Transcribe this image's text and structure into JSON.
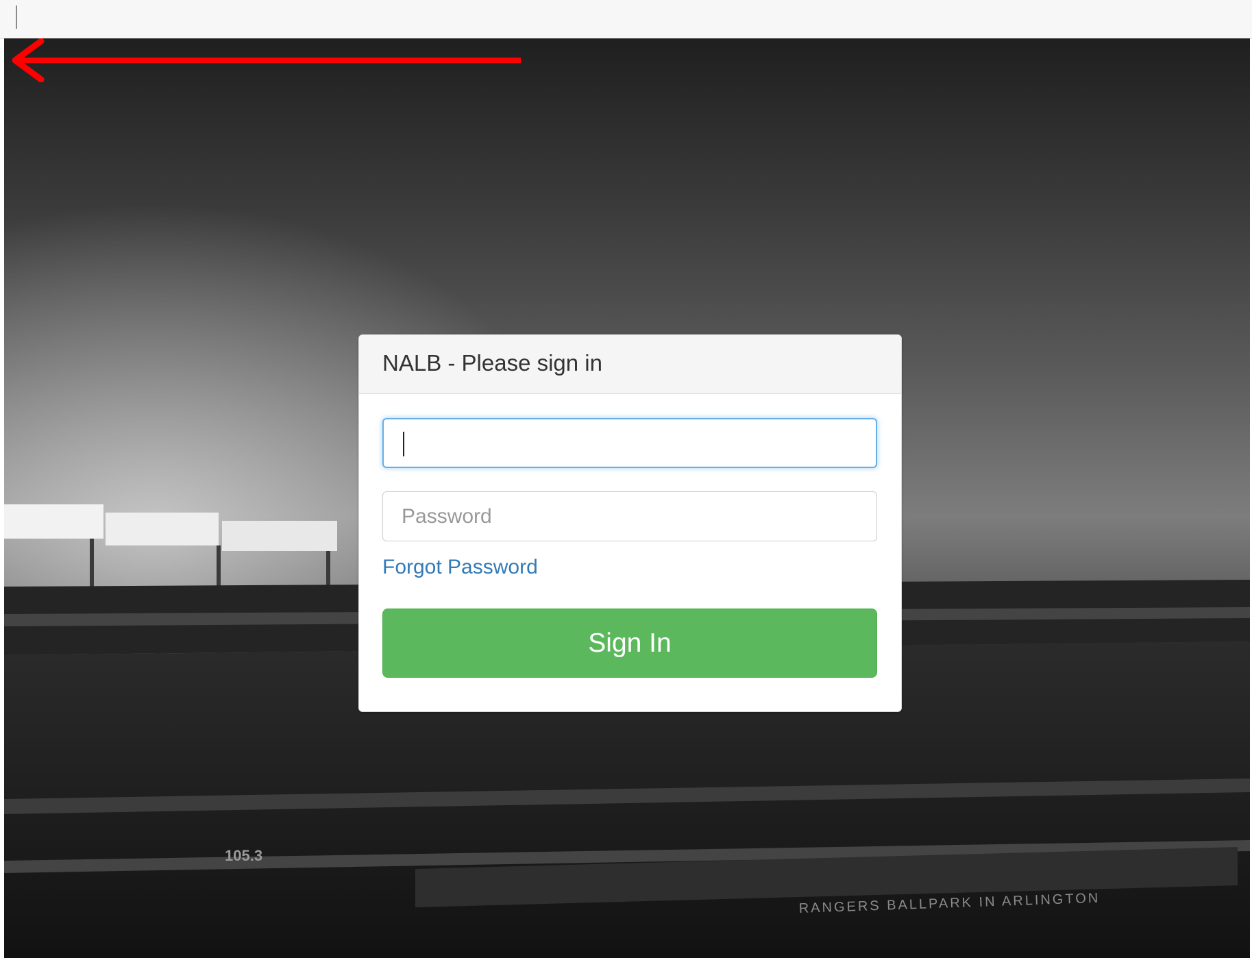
{
  "login": {
    "header_title": "NALB - Please sign in",
    "username_value": "",
    "password_placeholder": "Password",
    "forgot_label": "Forgot Password",
    "signin_label": "Sign In"
  },
  "background": {
    "banner_text": "RANGERS BALLPARK IN ARLINGTON",
    "sign_text": "105.3"
  },
  "colors": {
    "signin_button": "#5cb85c",
    "link": "#337ab7",
    "focus_border": "#66afe9",
    "annotation_arrow": "#ff0000"
  },
  "icons": {
    "annotation": "red-arrow-left-icon"
  }
}
